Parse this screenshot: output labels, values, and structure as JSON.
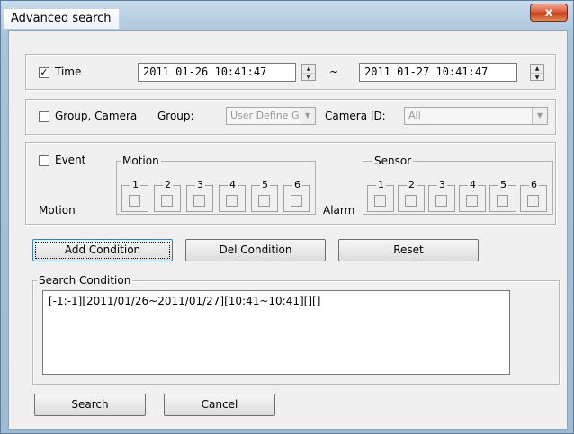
{
  "window": {
    "title": "Advanced search",
    "close_glyph": "x"
  },
  "time": {
    "checkbox_label": "Time",
    "checked": true,
    "start": "2011 01-26 10:41:47",
    "separator": "~",
    "end": "2011 01-27 10:41:47"
  },
  "group_camera": {
    "checkbox_label": "Group, Camera",
    "checked": false,
    "group_label": "Group:",
    "group_value": "User Define G",
    "camera_label": "Camera ID:",
    "camera_value": "All"
  },
  "event": {
    "checkbox_label": "Event",
    "checked": false,
    "motion_group_label": "Motion",
    "motion_row_label": "Motion",
    "sensor_group_label": "Sensor",
    "alarm_label": "Alarm",
    "motion_channels": [
      "1",
      "2",
      "3",
      "4",
      "5",
      "6"
    ],
    "sensor_channels": [
      "1",
      "2",
      "3",
      "4",
      "5",
      "6"
    ]
  },
  "buttons": {
    "add_condition": "Add Condition",
    "del_condition": "Del Condition",
    "reset": "Reset",
    "search": "Search",
    "cancel": "Cancel"
  },
  "search_condition": {
    "label": "Search Condition",
    "text": "[-1:-1][2011/01/26~2011/01/27][10:41~10:41][][]"
  }
}
